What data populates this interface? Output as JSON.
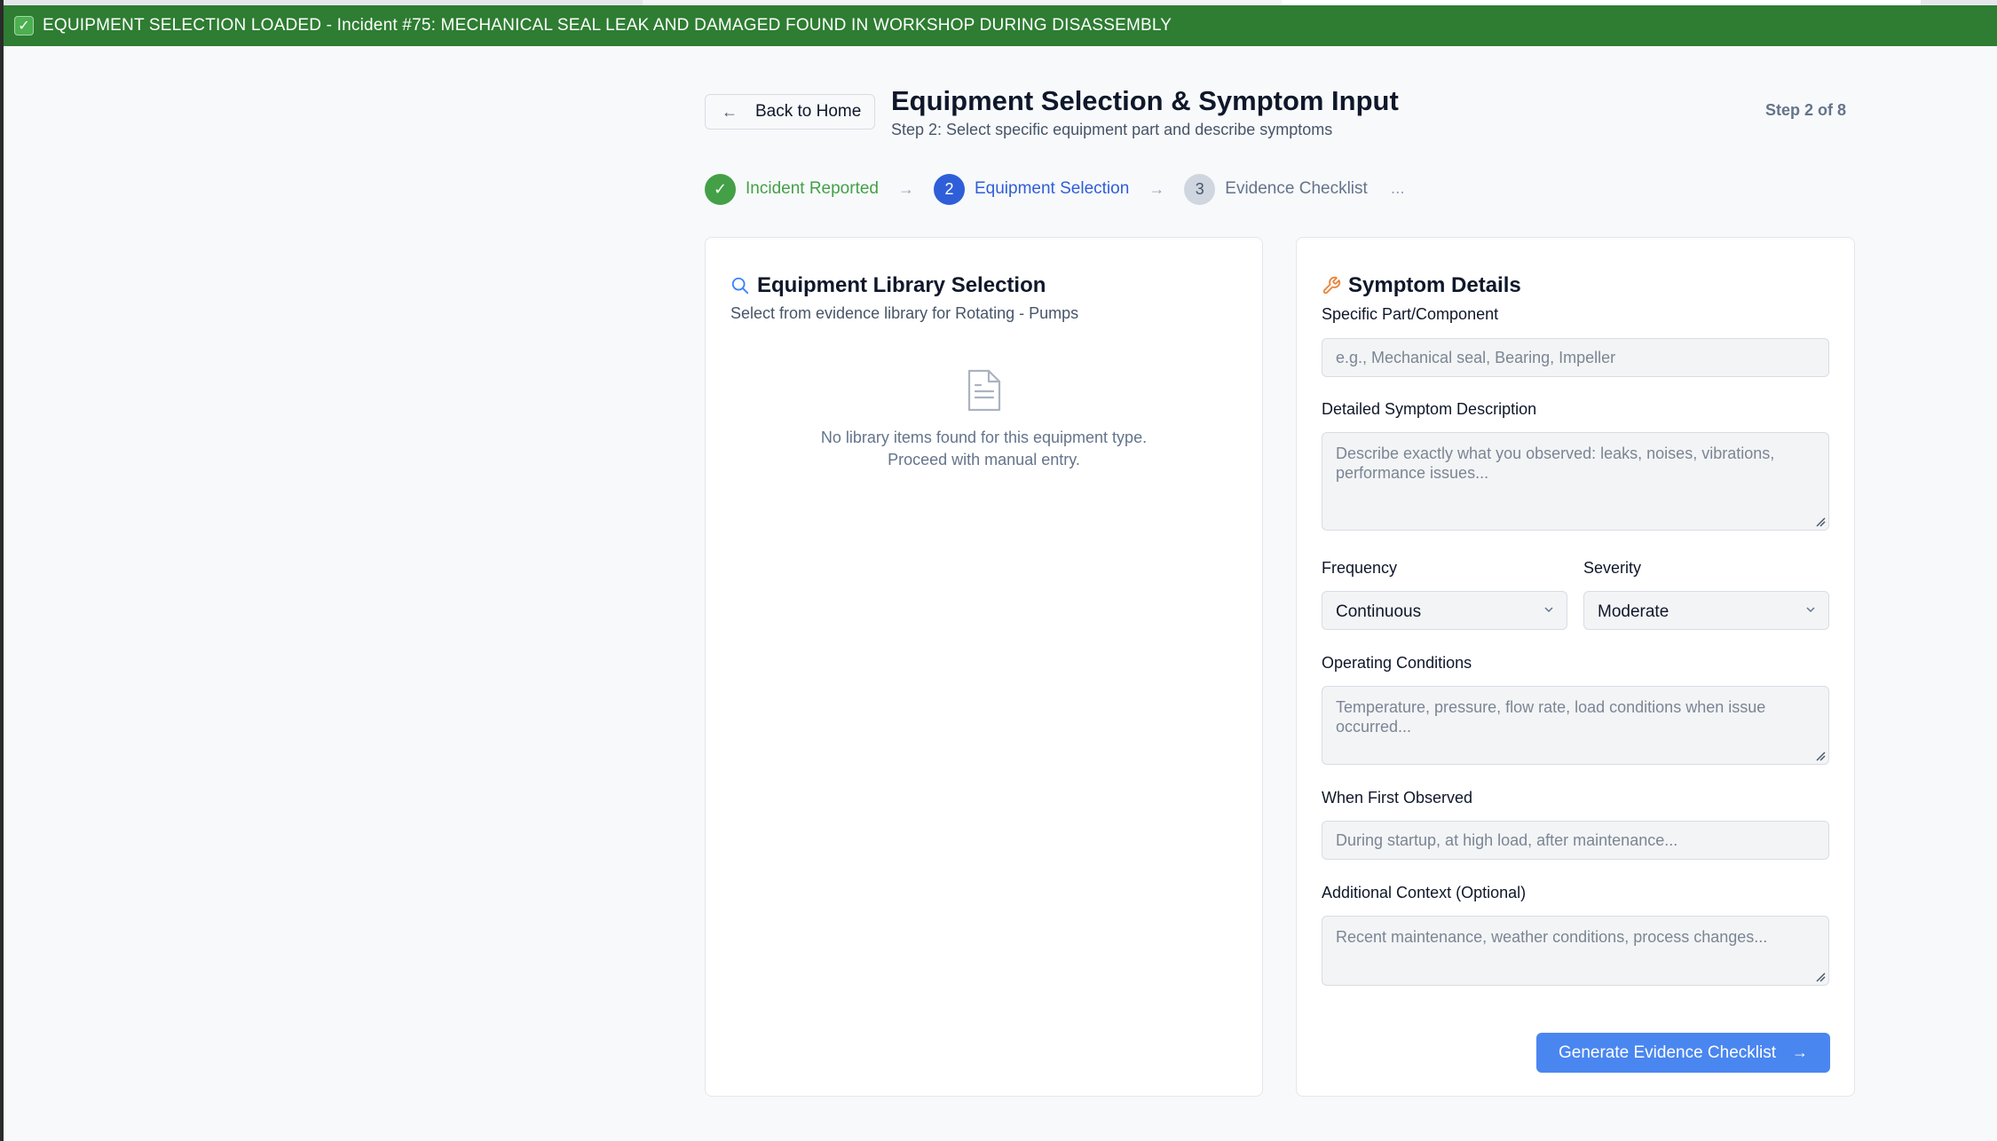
{
  "banner": {
    "text": "EQUIPMENT SELECTION LOADED - Incident #75: MECHANICAL SEAL LEAK AND DAMAGED FOUND IN WORKSHOP DURING DISASSEMBLY",
    "icon": "check-box-icon",
    "color": "#2e7d32"
  },
  "header": {
    "back_label": "Back to Home",
    "title": "Equipment Selection & Symptom Input",
    "subtitle": "Step 2: Select specific equipment part and describe symptoms",
    "step_badge": "Step 2 of 8"
  },
  "stepper": {
    "steps": [
      {
        "number": "✓",
        "label": "Incident Reported",
        "state": "done"
      },
      {
        "number": "2",
        "label": "Equipment Selection",
        "state": "active"
      },
      {
        "number": "3",
        "label": "Evidence Checklist",
        "state": "todo"
      }
    ],
    "more": "..."
  },
  "library": {
    "title": "Equipment Library Selection",
    "subtitle": "Select from evidence library for Rotating - Pumps",
    "empty_line1": "No library items found for this equipment type.",
    "empty_line2": "Proceed with manual entry."
  },
  "symptoms": {
    "title": "Symptom Details",
    "part_label": "Specific Part/Component",
    "part_placeholder": "e.g., Mechanical seal, Bearing, Impeller",
    "description_label": "Detailed Symptom Description",
    "description_placeholder": "Describe exactly what you observed: leaks, noises, vibrations, performance issues...",
    "frequency_label": "Frequency",
    "frequency_value": "Continuous",
    "severity_label": "Severity",
    "severity_value": "Moderate",
    "operating_label": "Operating Conditions",
    "operating_placeholder": "Temperature, pressure, flow rate, load conditions when issue occurred...",
    "first_observed_label": "When First Observed",
    "first_observed_placeholder": "During startup, at high load, after maintenance...",
    "context_label": "Additional Context (Optional)",
    "context_placeholder": "Recent maintenance, weather conditions, process changes...",
    "submit_label": "Generate Evidence Checklist"
  },
  "colors": {
    "primary": "#2f5ed9",
    "button": "#4a86f0",
    "success": "#43a047",
    "wrench": "#e8853a"
  }
}
